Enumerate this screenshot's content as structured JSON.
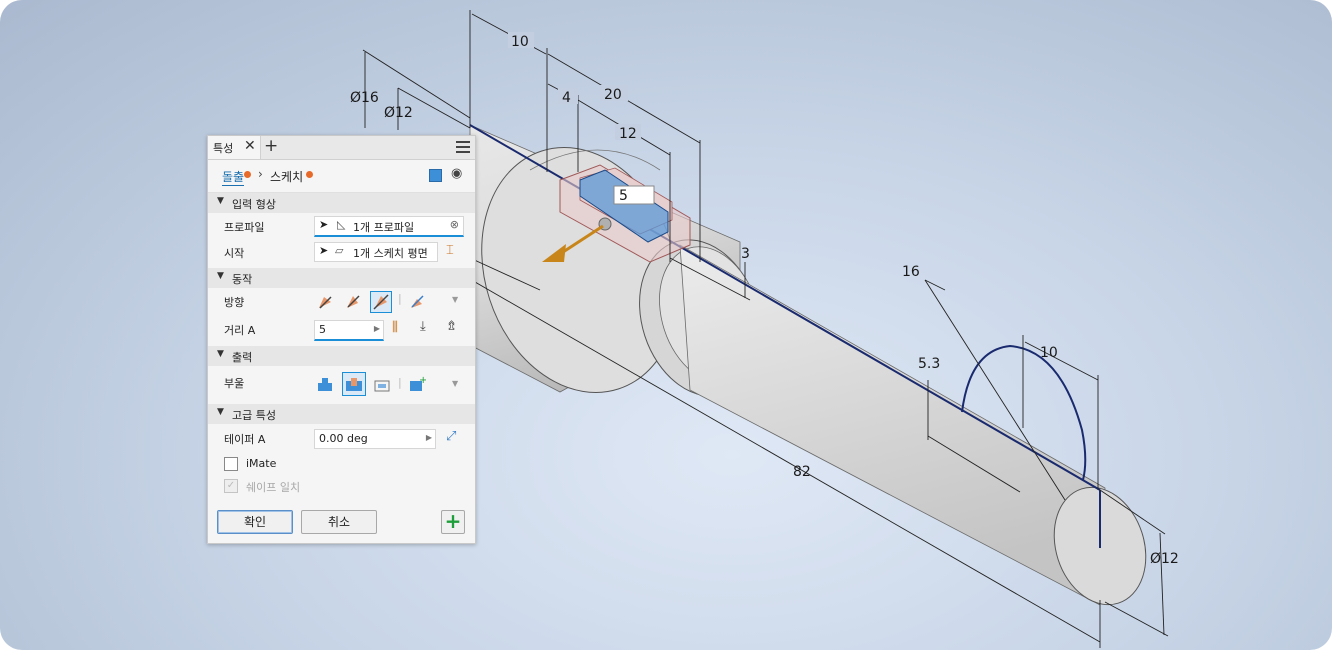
{
  "panel": {
    "tab_title": "특성",
    "breadcrumb": {
      "feature": "돌출",
      "separator": "›",
      "sketch": "스케치"
    },
    "sections": {
      "input_geometry": {
        "title": "입력 형상",
        "profile_label": "프로파일",
        "profile_value": "1개 프로파일",
        "start_label": "시작",
        "start_value": "1개 스케치 평면"
      },
      "behavior": {
        "title": "동작",
        "direction_label": "방향",
        "distance_label": "거리 A",
        "distance_value": "5"
      },
      "output": {
        "title": "출력",
        "boolean_label": "부울"
      },
      "advanced": {
        "title": "고급 특성",
        "taper_label": "테이퍼 A",
        "taper_value": "0.00 deg",
        "imate_label": "iMate",
        "shape_match_label": "쉐이프 일치"
      }
    },
    "buttons": {
      "ok": "확인",
      "cancel": "취소"
    }
  },
  "viewport": {
    "input_box_value": "5",
    "dimensions": {
      "d16": "Ø16",
      "d12_top": "Ø12",
      "d12_end": "Ø12",
      "len10_top": "10",
      "len4": "4",
      "len20": "20",
      "len12": "12",
      "len3": "3",
      "len16": "16",
      "len5_3": "5.3",
      "len10_end": "10",
      "len82": "82"
    },
    "colors": {
      "accent": "#1a8fd8",
      "edge": "#1a2a6e",
      "arrow": "#c8861a",
      "ok_plus": "#1e9e3a"
    }
  }
}
